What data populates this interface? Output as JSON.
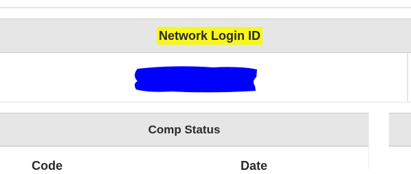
{
  "network_panel": {
    "header_label": "Network Login ID",
    "header_highlight_color": "#f7f71e",
    "value_redaction_color": "#0000ff"
  },
  "comp_status_panel": {
    "header_label": "Comp Status",
    "columns": [
      "Code",
      "Date"
    ]
  },
  "colors": {
    "header_bg": "#e6e6e6",
    "border": "#c9c9c9"
  }
}
